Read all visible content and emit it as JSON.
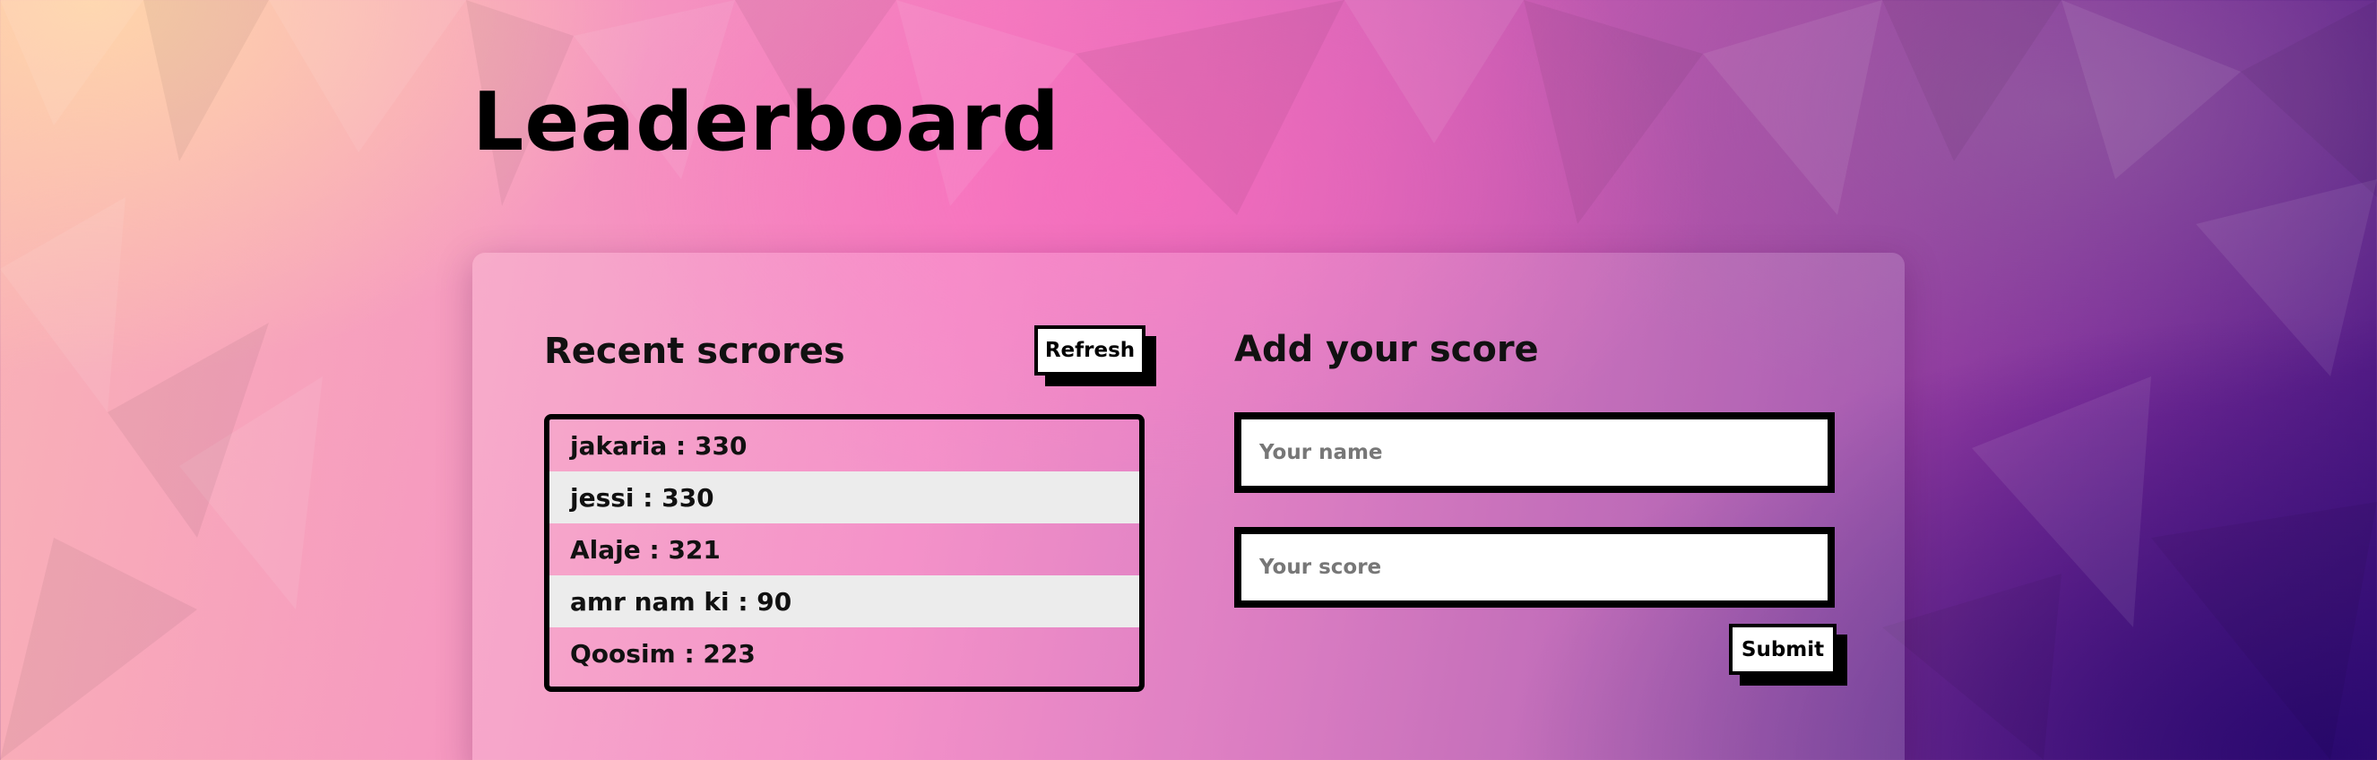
{
  "page": {
    "title": "Leaderboard"
  },
  "recent": {
    "heading": "Recent scrores",
    "refresh_label": "Refresh",
    "scores": [
      {
        "text": "jakaria : 330"
      },
      {
        "text": "jessi : 330"
      },
      {
        "text": "Alaje : 321"
      },
      {
        "text": "amr nam ki : 90"
      },
      {
        "text": "Qoosim : 223"
      }
    ]
  },
  "add": {
    "heading": "Add your score",
    "name_placeholder": "Your name",
    "score_placeholder": "Your score",
    "submit_label": "Submit"
  },
  "colors": {
    "text": "#000000",
    "row_alt": "#ececec",
    "background_warm": "#f9b2b6",
    "background_pink": "#f27dbf",
    "background_purple": "#4b1882"
  }
}
